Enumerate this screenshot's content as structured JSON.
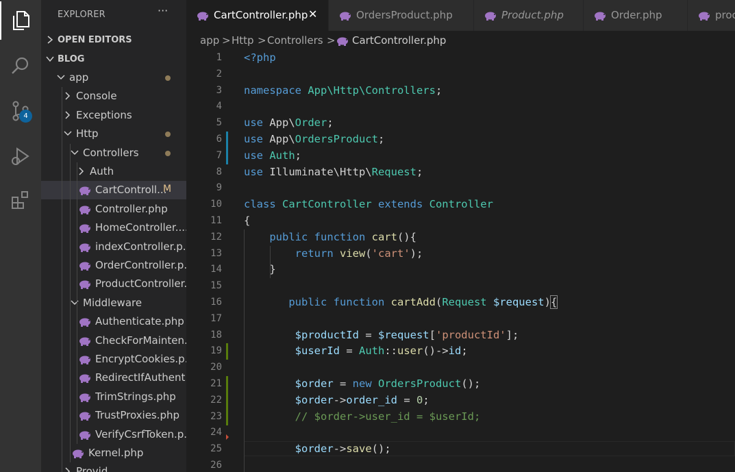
{
  "explorer": {
    "title": "EXPLORER",
    "more": "···",
    "open_editors": "OPEN EDITORS",
    "project": "BLOG",
    "tree": [
      {
        "label": "app",
        "type": "folder",
        "expanded": true,
        "depth": 0,
        "dot": true
      },
      {
        "label": "Console",
        "type": "folder",
        "expanded": false,
        "depth": 1
      },
      {
        "label": "Exceptions",
        "type": "folder",
        "expanded": false,
        "depth": 1
      },
      {
        "label": "Http",
        "type": "folder",
        "expanded": true,
        "depth": 1,
        "dot": true
      },
      {
        "label": "Controllers",
        "type": "folder",
        "expanded": true,
        "depth": 2,
        "dot": true
      },
      {
        "label": "Auth",
        "type": "folder",
        "expanded": false,
        "depth": 3
      },
      {
        "label": "CartControll...",
        "type": "file",
        "depth": 3,
        "badge": "M",
        "selected": true
      },
      {
        "label": "Controller.php",
        "type": "file",
        "depth": 3
      },
      {
        "label": "HomeController....",
        "type": "file",
        "depth": 3
      },
      {
        "label": "indexController.p...",
        "type": "file",
        "depth": 3
      },
      {
        "label": "OrderController.p...",
        "type": "file",
        "depth": 3
      },
      {
        "label": "ProductController....",
        "type": "file",
        "depth": 3
      },
      {
        "label": "Middleware",
        "type": "folder",
        "expanded": true,
        "depth": 2
      },
      {
        "label": "Authenticate.php",
        "type": "file",
        "depth": 3
      },
      {
        "label": "CheckForMainten...",
        "type": "file",
        "depth": 3
      },
      {
        "label": "EncryptCookies.p...",
        "type": "file",
        "depth": 3
      },
      {
        "label": "RedirectIfAuthent...",
        "type": "file",
        "depth": 3
      },
      {
        "label": "TrimStrings.php",
        "type": "file",
        "depth": 3
      },
      {
        "label": "TrustProxies.php",
        "type": "file",
        "depth": 3
      },
      {
        "label": "VerifyCsrfToken.p...",
        "type": "file",
        "depth": 3
      },
      {
        "label": "Kernel.php",
        "type": "file",
        "depth": 2
      },
      {
        "label": "Provid...",
        "type": "folder",
        "expanded": false,
        "depth": 1
      }
    ]
  },
  "scm_badge": "4",
  "tabs": [
    {
      "label": "CartController.php",
      "active": true,
      "close": "✕"
    },
    {
      "label": "OrdersProduct.php",
      "active": false
    },
    {
      "label": "Product.php",
      "active": false,
      "italic": true
    },
    {
      "label": "Order.php",
      "active": false
    },
    {
      "label": "proc",
      "active": false
    }
  ],
  "breadcrumb": [
    "app",
    "Http",
    "Controllers",
    "CartController.php"
  ],
  "breadcrumb_sep": ">",
  "colors": {
    "accent": "#0e639c",
    "modified": "#e2c08d",
    "gutter_modified": "#1b81a8",
    "gutter_added": "#587c0c"
  },
  "code": [
    {
      "n": "1",
      "t": [
        [
          "kw",
          "<?php"
        ]
      ]
    },
    {
      "n": "2",
      "t": []
    },
    {
      "n": "3",
      "t": [
        [
          "kw",
          "namespace "
        ],
        [
          "ns",
          "App\\Http\\Controllers"
        ],
        [
          "plain",
          ";"
        ]
      ]
    },
    {
      "n": "4",
      "t": []
    },
    {
      "n": "5",
      "t": [
        [
          "kw",
          "use "
        ],
        [
          "plain",
          "App\\"
        ],
        [
          "ns",
          "Order"
        ],
        [
          "plain",
          ";"
        ]
      ]
    },
    {
      "n": "6",
      "t": [
        [
          "kw",
          "use "
        ],
        [
          "plain",
          "App\\"
        ],
        [
          "ns",
          "OrdersProduct"
        ],
        [
          "plain",
          ";"
        ]
      ],
      "mark": "modified"
    },
    {
      "n": "7",
      "t": [
        [
          "kw",
          "use "
        ],
        [
          "ns",
          "Auth"
        ],
        [
          "plain",
          ";"
        ]
      ],
      "mark": "modified"
    },
    {
      "n": "8",
      "t": [
        [
          "kw",
          "use "
        ],
        [
          "plain",
          "Illuminate\\Http\\"
        ],
        [
          "ns",
          "Request"
        ],
        [
          "plain",
          ";"
        ]
      ]
    },
    {
      "n": "9",
      "t": []
    },
    {
      "n": "10",
      "t": [
        [
          "kw",
          "class "
        ],
        [
          "ns",
          "CartController "
        ],
        [
          "kw",
          "extends "
        ],
        [
          "ns",
          "Controller"
        ]
      ]
    },
    {
      "n": "11",
      "t": [
        [
          "plain",
          "{"
        ]
      ]
    },
    {
      "n": "12",
      "t": [
        [
          "plain",
          "    "
        ],
        [
          "kw",
          "public function "
        ],
        [
          "fn",
          "cart"
        ],
        [
          "plain",
          "(){"
        ]
      ]
    },
    {
      "n": "13",
      "t": [
        [
          "plain",
          "        "
        ],
        [
          "kw",
          "return "
        ],
        [
          "fn",
          "view"
        ],
        [
          "plain",
          "("
        ],
        [
          "str",
          "'cart'"
        ],
        [
          "plain",
          ");"
        ]
      ]
    },
    {
      "n": "14",
      "t": [
        [
          "plain",
          "    }"
        ]
      ]
    },
    {
      "n": "15",
      "t": []
    },
    {
      "n": "16",
      "t": [
        [
          "plain",
          "       "
        ],
        [
          "kw",
          "public function "
        ],
        [
          "fn",
          "cartAdd"
        ],
        [
          "plain",
          "("
        ],
        [
          "ns",
          "Request "
        ],
        [
          "var",
          "$request"
        ],
        [
          "plain",
          ")"
        ],
        [
          "bracket",
          "{"
        ]
      ]
    },
    {
      "n": "17",
      "t": []
    },
    {
      "n": "18",
      "t": [
        [
          "plain",
          "        "
        ],
        [
          "var",
          "$productId"
        ],
        [
          "plain",
          " = "
        ],
        [
          "var",
          "$request"
        ],
        [
          "plain",
          "["
        ],
        [
          "str",
          "'productId'"
        ],
        [
          "plain",
          "];"
        ]
      ]
    },
    {
      "n": "19",
      "t": [
        [
          "plain",
          "        "
        ],
        [
          "var",
          "$userId"
        ],
        [
          "plain",
          " = "
        ],
        [
          "ns",
          "Auth"
        ],
        [
          "plain",
          "::"
        ],
        [
          "fn",
          "user"
        ],
        [
          "plain",
          "()->"
        ],
        [
          "var",
          "id"
        ],
        [
          "plain",
          ";"
        ]
      ],
      "mark": "added"
    },
    {
      "n": "20",
      "t": []
    },
    {
      "n": "21",
      "t": [
        [
          "plain",
          "        "
        ],
        [
          "var",
          "$order"
        ],
        [
          "plain",
          " = "
        ],
        [
          "kw",
          "new "
        ],
        [
          "ns",
          "OrdersProduct"
        ],
        [
          "plain",
          "();"
        ]
      ],
      "mark": "added"
    },
    {
      "n": "22",
      "t": [
        [
          "plain",
          "        "
        ],
        [
          "var",
          "$order"
        ],
        [
          "plain",
          "->"
        ],
        [
          "var",
          "order_id"
        ],
        [
          "plain",
          " = "
        ],
        [
          "num",
          "0"
        ],
        [
          "plain",
          ";"
        ]
      ],
      "mark": "added"
    },
    {
      "n": "23",
      "t": [
        [
          "plain",
          "        "
        ],
        [
          "cm",
          "// $order->user_id = $userId;"
        ]
      ],
      "mark": "added"
    },
    {
      "n": "24",
      "t": [],
      "mark": "deleted"
    },
    {
      "n": "25",
      "t": [
        [
          "plain",
          "        "
        ],
        [
          "var",
          "$order"
        ],
        [
          "plain",
          "->"
        ],
        [
          "fn",
          "save"
        ],
        [
          "plain",
          "();"
        ]
      ],
      "current": true
    },
    {
      "n": "26",
      "t": []
    }
  ]
}
